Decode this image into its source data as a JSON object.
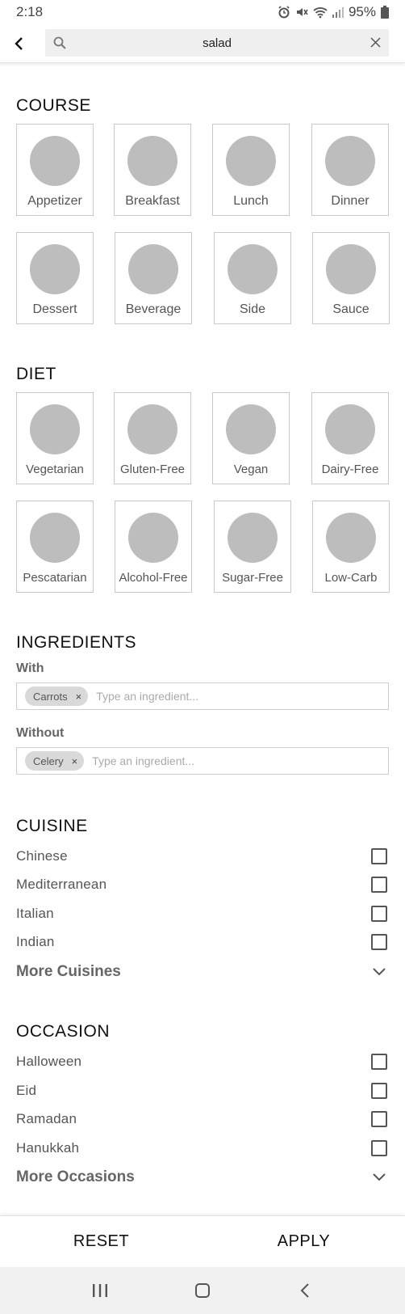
{
  "status_bar": {
    "time": "2:18",
    "battery": "95%"
  },
  "search": {
    "value": "salad"
  },
  "course": {
    "title": "COURSE",
    "items": [
      "Appetizer",
      "Breakfast",
      "Lunch",
      "Dinner",
      "Dessert",
      "Beverage",
      "Side",
      "Sauce"
    ]
  },
  "diet": {
    "title": "DIET",
    "items": [
      "Vegetarian",
      "Gluten-Free",
      "Vegan",
      "Dairy-Free",
      "Pescatarian",
      "Alcohol-Free",
      "Sugar-Free",
      "Low-Carb"
    ]
  },
  "ingredients": {
    "title": "INGREDIENTS",
    "with_label": "With",
    "with_chip": "Carrots",
    "without_label": "Without",
    "without_chip": "Celery",
    "placeholder": "Type an ingredient...",
    "chip_remove": "×"
  },
  "cuisine": {
    "title": "CUISINE",
    "items": [
      "Chinese",
      "Mediterranean",
      "Italian",
      "Indian"
    ],
    "more": "More Cuisines"
  },
  "occasion": {
    "title": "OCCASION",
    "items": [
      "Halloween",
      "Eid",
      "Ramadan",
      "Hanukkah"
    ],
    "more": "More Occasions"
  },
  "actions": {
    "reset": "RESET",
    "apply": "APPLY"
  },
  "icons": {
    "back": "back-arrow-icon",
    "search": "search-icon",
    "clear": "close-icon",
    "expand": "chevron-down-icon",
    "nav_recents": "recents-icon",
    "nav_home": "home-icon",
    "nav_back": "nav-back-icon"
  }
}
